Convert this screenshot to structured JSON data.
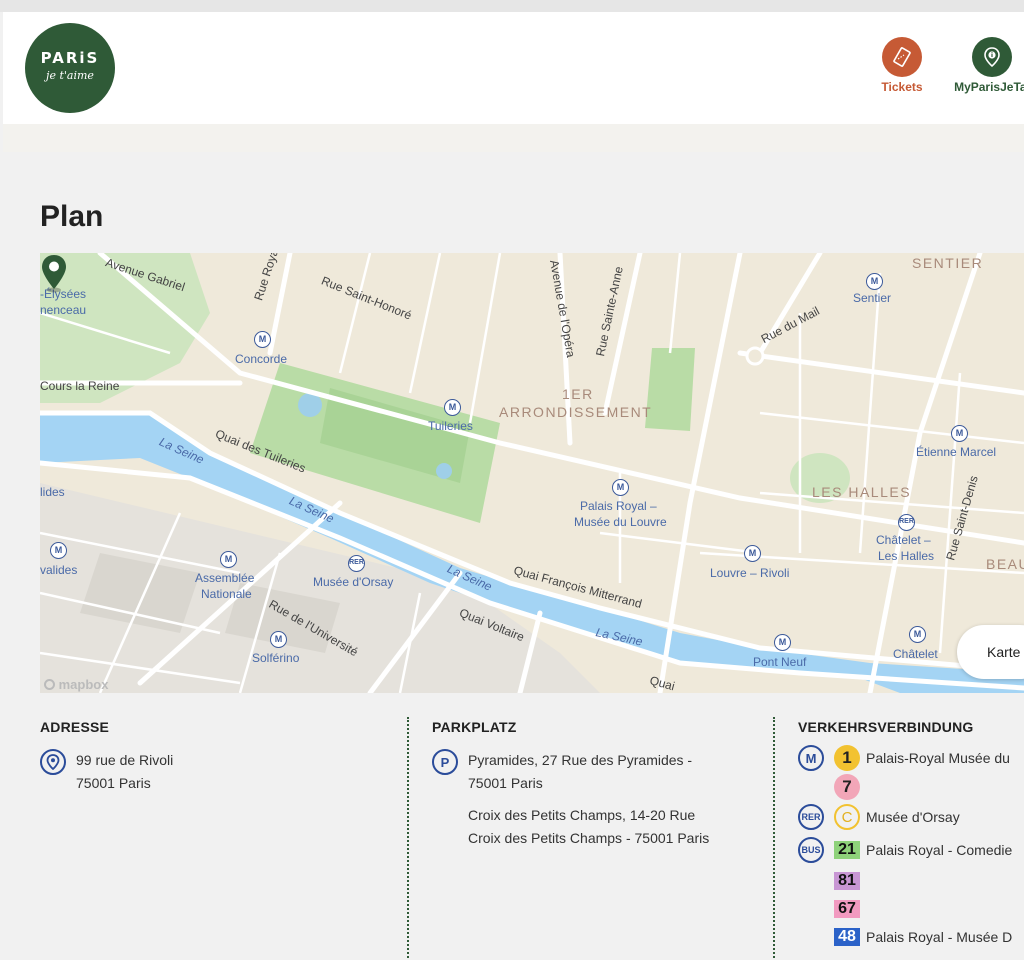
{
  "header": {
    "logo_line1": "PARiS",
    "logo_line2": "je t'aime",
    "tickets_label": "Tickets",
    "mypjt_label": "MyParisJeTai"
  },
  "page": {
    "title": "Plan"
  },
  "map": {
    "labels": {
      "sentier_district": "SENTIER",
      "sentier": "Sentier",
      "avenue_gabriel": "Avenue Gabriel",
      "rue_royale": "Rue Royale",
      "rue_saint_honore": "Rue Saint-Honoré",
      "avenue_opera": "Avenue de l'Opéra",
      "rue_sainte_anne": "Rue Sainte-Anne",
      "rue_du_mail": "Rue du Mail",
      "champs_elysees": "-Élysées",
      "clemenceau": "nenceau",
      "concorde": "Concorde",
      "cours_la_reine": "Cours la Reine",
      "arr_1": "1ER",
      "arrondissement": "ARRONDISSEMENT",
      "tuileries": "Tuileries",
      "etienne_marcel": "Étienne Marcel",
      "quai_tuileries": "Quai des Tuileries",
      "la_seine_1": "La Seine",
      "la_seine_2": "La Seine",
      "la_seine_3": "La Seine",
      "la_seine_4": "La Seine",
      "palais_royal": "Palais Royal –",
      "musee_louvre": "Musée du Louvre",
      "les_halles": "LES HALLES",
      "rue_saint_denis": "Rue Saint-Denis",
      "invalides_top": "lides",
      "invalides": "valides",
      "chatelet_les_halles_1": "Châtelet –",
      "chatelet_les_halles_2": "Les Halles",
      "beau": "BEAU",
      "assemblee_1": "Assemblée",
      "assemblee_2": "Nationale",
      "musee_orsay": "Musée d'Orsay",
      "quai_mitterrand": "Quai François Mitterrand",
      "louvre_rivoli": "Louvre – Rivoli",
      "rue_universite": "Rue de l'Université",
      "quai_voltaire": "Quai Voltaire",
      "solferino": "Solférino",
      "pont_neuf": "Pont Neuf",
      "chatelet": "Châtelet",
      "quai_bottom": "Quai"
    },
    "toggle_label": "Karte",
    "attribution": "mapbox"
  },
  "address": {
    "heading": "ADRESSE",
    "line1": "99 rue de Rivoli",
    "line2": "75001 Paris"
  },
  "parking": {
    "heading": "PARKPLATZ",
    "p1_line1": "Pyramides, 27 Rue des Pyramides -",
    "p1_line2": "75001 Paris",
    "p2_line1": "Croix des Petits Champs, 14-20 Rue",
    "p2_line2": "Croix des Petits Champs - 75001 Paris"
  },
  "transport": {
    "heading": "VERKEHRSVERBINDUNG",
    "metro_badge": "M",
    "rer_badge": "RER",
    "bus_badge": "BUS",
    "metro_line_1": "1",
    "metro_line_7": "7",
    "metro_stop": "Palais-Royal Musée du",
    "rer_line": "C",
    "rer_stop": "Musée d'Orsay",
    "bus_21": "21",
    "bus_21_stop": "Palais Royal - Comedie",
    "bus_81": "81",
    "bus_67": "67",
    "bus_48": "48",
    "bus_48_stop": "Palais Royal - Musée D",
    "colors": {
      "m1": "#f2c230",
      "m7": "#f2a6b8",
      "rerc": "#f2c230",
      "b21": "#8ed27a",
      "b81": "#c896d4",
      "b67": "#f29ac0",
      "b48": "#2b62c8"
    }
  }
}
